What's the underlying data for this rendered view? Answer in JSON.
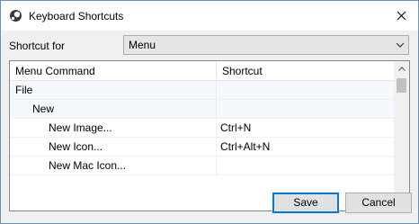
{
  "window": {
    "title": "Keyboard Shortcuts",
    "app_icon": "app-logo-icon",
    "close_icon": "close-icon"
  },
  "shortcut_for": {
    "label": "Shortcut for",
    "selected": "Menu",
    "dropdown_icon": "chevron-down-icon"
  },
  "grid": {
    "columns": [
      "Menu Command",
      "Shortcut"
    ],
    "rows": [
      {
        "command": "File",
        "shortcut": "",
        "level": 0,
        "group": true
      },
      {
        "command": "New",
        "shortcut": "",
        "level": 1,
        "group": true
      },
      {
        "command": "New Image...",
        "shortcut": "Ctrl+N",
        "level": 2,
        "group": false
      },
      {
        "command": "New Icon...",
        "shortcut": "Ctrl+Alt+N",
        "level": 2,
        "group": false
      },
      {
        "command": "New Mac Icon...",
        "shortcut": "",
        "level": 2,
        "group": false
      }
    ],
    "scroll_up_icon": "scroll-up-arrow-icon",
    "scroll_down_icon": "scroll-down-arrow-icon"
  },
  "buttons": {
    "save": "Save",
    "cancel": "Cancel"
  }
}
